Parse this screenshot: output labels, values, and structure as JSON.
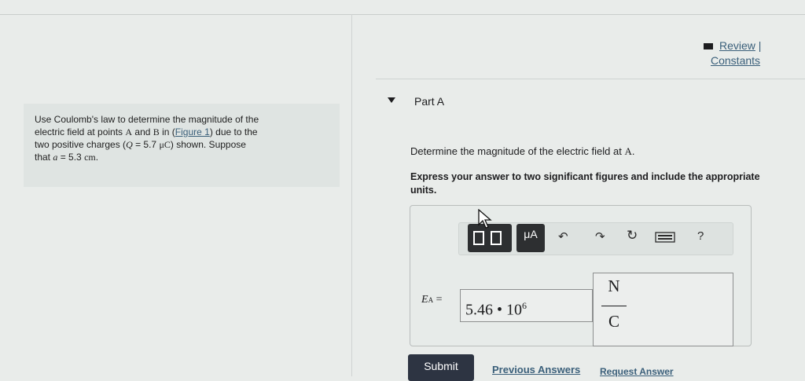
{
  "header": {
    "review_label": "Review",
    "review_separator": "|",
    "constants_label": "Constants"
  },
  "problem": {
    "line1": "Use Coulomb's law to determine the magnitude of the",
    "line2_a": "electric field at points ",
    "point_a": "A",
    "line2_b": " and ",
    "point_b": "B",
    "line2_c": " in (",
    "figure_link": "Figure 1",
    "line2_d": ") due to the",
    "line3_a": "two positive charges (",
    "charge_var": "Q",
    "line3_b": " = 5.7 ",
    "charge_unit": "μC",
    "line3_c": ") shown. Suppose",
    "line4_a": "that ",
    "dist_var": "a",
    "line4_b": " = 5.3 ",
    "dist_unit": "cm",
    "line4_c": "."
  },
  "part": {
    "title": "Part A",
    "question_text": "Determine the magnitude of the electric field at ",
    "question_point": "A",
    "question_end": ".",
    "instruction": "Express your answer to two significant figures and include the appropriate units."
  },
  "toolbar": {
    "mu_label": "μA",
    "undo_icon": "undo-icon",
    "redo_icon": "redo-icon",
    "reset_icon": "reset-icon",
    "keyboard_icon": "keyboard-icon",
    "help_label": "?"
  },
  "answer": {
    "var_symbol": "E",
    "var_sub": "A",
    "equals": "=",
    "mantissa": "5.46",
    "times": "•",
    "base": "10",
    "exponent": "6",
    "unit_numerator": "N",
    "unit_denominator": "C"
  },
  "actions": {
    "submit_label": "Submit",
    "previous_answers_label": "Previous Answers",
    "request_answer_label": "Request Answer"
  }
}
